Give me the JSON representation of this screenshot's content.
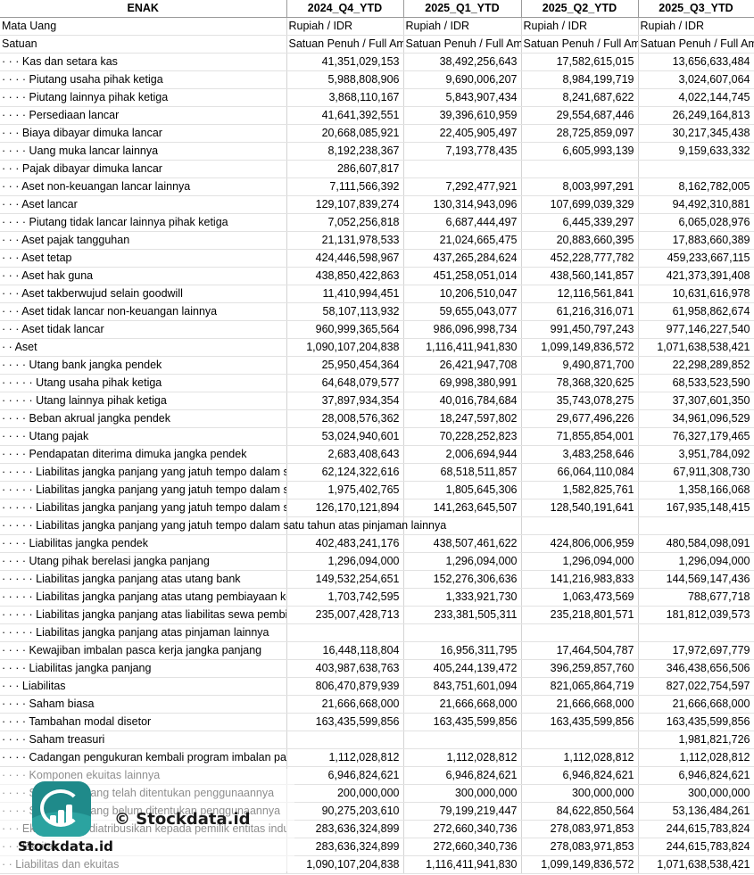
{
  "header": {
    "label": "ENAK",
    "periods": [
      "2024_Q4_YTD",
      "2025_Q1_YTD",
      "2025_Q2_YTD",
      "2025_Q3_YTD"
    ]
  },
  "meta_rows": [
    {
      "label": "Mata Uang",
      "values": [
        "Rupiah / IDR",
        "Rupiah / IDR",
        "Rupiah / IDR",
        "Rupiah / IDR"
      ]
    },
    {
      "label": "Satuan",
      "values": [
        "Satuan Penuh / Full Amount",
        "Satuan Penuh / Full Amount",
        "Satuan Penuh / Full Amount",
        "Satuan Penuh / Full Amount"
      ]
    }
  ],
  "rows": [
    {
      "label": "· · · Kas dan setara kas",
      "values": [
        "41,351,029,153",
        "38,492,256,643",
        "17,582,615,015",
        "13,656,633,484"
      ]
    },
    {
      "label": "· · · · Piutang usaha pihak ketiga",
      "values": [
        "5,988,808,906",
        "9,690,006,207",
        "8,984,199,719",
        "3,024,607,064"
      ]
    },
    {
      "label": "· · · · Piutang lainnya pihak ketiga",
      "values": [
        "3,868,110,167",
        "5,843,907,434",
        "8,241,687,622",
        "4,022,144,745"
      ]
    },
    {
      "label": "· · · · Persediaan lancar",
      "values": [
        "41,641,392,551",
        "39,396,610,959",
        "29,554,687,446",
        "26,249,164,813"
      ]
    },
    {
      "label": "· · · Biaya dibayar dimuka lancar",
      "values": [
        "20,668,085,921",
        "22,405,905,497",
        "28,725,859,097",
        "30,217,345,438"
      ]
    },
    {
      "label": "· · · · Uang muka lancar lainnya",
      "values": [
        "8,192,238,367",
        "7,193,778,435",
        "6,605,993,139",
        "9,159,633,332"
      ]
    },
    {
      "label": "· · · Pajak dibayar dimuka lancar",
      "values": [
        "286,607,817",
        "",
        "",
        ""
      ]
    },
    {
      "label": "· · · Aset non-keuangan lancar lainnya",
      "values": [
        "7,111,566,392",
        "7,292,477,921",
        "8,003,997,291",
        "8,162,782,005"
      ]
    },
    {
      "label": "· · · Aset lancar",
      "values": [
        "129,107,839,274",
        "130,314,943,096",
        "107,699,039,329",
        "94,492,310,881"
      ]
    },
    {
      "label": "· · · · Piutang tidak lancar lainnya pihak ketiga",
      "values": [
        "7,052,256,818",
        "6,687,444,497",
        "6,445,339,297",
        "6,065,028,976"
      ]
    },
    {
      "label": "· · · Aset pajak tangguhan",
      "values": [
        "21,131,978,533",
        "21,024,665,475",
        "20,883,660,395",
        "17,883,660,389"
      ]
    },
    {
      "label": "· · · Aset tetap",
      "values": [
        "424,446,598,967",
        "437,265,284,624",
        "452,228,777,782",
        "459,233,667,115"
      ]
    },
    {
      "label": "· · · Aset hak guna",
      "values": [
        "438,850,422,863",
        "451,258,051,014",
        "438,560,141,857",
        "421,373,391,408"
      ]
    },
    {
      "label": "· · · Aset takberwujud selain goodwill",
      "values": [
        "11,410,994,451",
        "10,206,510,047",
        "12,116,561,841",
        "10,631,616,978"
      ]
    },
    {
      "label": "· · · Aset tidak lancar non-keuangan lainnya",
      "values": [
        "58,107,113,932",
        "59,655,043,077",
        "61,216,316,071",
        "61,958,862,674"
      ]
    },
    {
      "label": "· · · Aset tidak lancar",
      "values": [
        "960,999,365,564",
        "986,096,998,734",
        "991,450,797,243",
        "977,146,227,540"
      ]
    },
    {
      "label": "· · Aset",
      "values": [
        "1,090,107,204,838",
        "1,116,411,941,830",
        "1,099,149,836,572",
        "1,071,638,538,421"
      ]
    },
    {
      "label": "· · · · Utang bank jangka pendek",
      "values": [
        "25,950,454,364",
        "26,421,947,708",
        "9,490,871,700",
        "22,298,289,852"
      ]
    },
    {
      "label": "· · · · · Utang usaha pihak ketiga",
      "values": [
        "64,648,079,577",
        "69,998,380,991",
        "78,368,320,625",
        "68,533,523,590"
      ]
    },
    {
      "label": "· · · · · Utang lainnya pihak ketiga",
      "values": [
        "37,897,934,354",
        "40,016,784,684",
        "35,743,078,275",
        "37,307,601,350"
      ]
    },
    {
      "label": "· · · · Beban akrual jangka pendek",
      "values": [
        "28,008,576,362",
        "18,247,597,802",
        "29,677,496,226",
        "34,961,096,529"
      ]
    },
    {
      "label": "· · · · Utang pajak",
      "values": [
        "53,024,940,601",
        "70,228,252,823",
        "71,855,854,001",
        "76,327,179,465"
      ]
    },
    {
      "label": "· · · · Pendapatan diterima dimuka jangka pendek",
      "values": [
        "2,683,408,643",
        "2,006,694,944",
        "3,483,258,646",
        "3,951,784,092"
      ]
    },
    {
      "label": "· · · · · Liabilitas jangka panjang yang jatuh tempo dalam satu tahun atas utang bank",
      "values": [
        "62,124,322,616",
        "68,518,511,857",
        "66,064,110,084",
        "67,911,308,730"
      ]
    },
    {
      "label": "· · · · · Liabilitas jangka panjang yang jatuh tempo dalam satu tahun atas utang pembiayaan konsumen",
      "values": [
        "1,975,402,765",
        "1,805,645,306",
        "1,582,825,761",
        "1,358,166,068"
      ]
    },
    {
      "label": "· · · · · Liabilitas jangka panjang yang jatuh tempo dalam satu tahun atas liabilitas sewa pembiayaan",
      "values": [
        "126,170,121,894",
        "141,263,645,507",
        "128,540,191,641",
        "167,935,148,415"
      ]
    },
    {
      "label": "· · · · · Liabilitas jangka panjang yang jatuh tempo dalam satu tahun atas pinjaman lainnya",
      "values": [
        "",
        "",
        "",
        ""
      ],
      "overflow": true
    },
    {
      "label": "· · · · Liabilitas jangka pendek",
      "values": [
        "402,483,241,176",
        "438,507,461,622",
        "424,806,006,959",
        "480,584,098,091"
      ]
    },
    {
      "label": "· · · · Utang pihak berelasi jangka panjang",
      "values": [
        "1,296,094,000",
        "1,296,094,000",
        "1,296,094,000",
        "1,296,094,000"
      ]
    },
    {
      "label": "· · · · · Liabilitas jangka panjang atas utang bank",
      "values": [
        "149,532,254,651",
        "152,276,306,636",
        "141,216,983,833",
        "144,569,147,436"
      ]
    },
    {
      "label": "· · · · · Liabilitas jangka panjang atas utang pembiayaan konsumen",
      "values": [
        "1,703,742,595",
        "1,333,921,730",
        "1,063,473,569",
        "788,677,718"
      ]
    },
    {
      "label": "· · · · · Liabilitas jangka panjang atas liabilitas sewa pembiayaan",
      "values": [
        "235,007,428,713",
        "233,381,505,311",
        "235,218,801,571",
        "181,812,039,573"
      ]
    },
    {
      "label": "· · · · · Liabilitas jangka panjang atas pinjaman lainnya",
      "values": [
        "",
        "",
        "",
        ""
      ]
    },
    {
      "label": "· · · · Kewajiban imbalan pasca kerja jangka panjang",
      "values": [
        "16,448,118,804",
        "16,956,311,795",
        "17,464,504,787",
        "17,972,697,779"
      ]
    },
    {
      "label": "· · · · Liabilitas jangka panjang",
      "values": [
        "403,987,638,763",
        "405,244,139,472",
        "396,259,857,760",
        "346,438,656,506"
      ]
    },
    {
      "label": "· · · Liabilitas",
      "values": [
        "806,470,879,939",
        "843,751,601,094",
        "821,065,864,719",
        "827,022,754,597"
      ]
    },
    {
      "label": "· · · · Saham biasa",
      "values": [
        "21,666,668,000",
        "21,666,668,000",
        "21,666,668,000",
        "21,666,668,000"
      ]
    },
    {
      "label": "· · · · Tambahan modal disetor",
      "values": [
        "163,435,599,856",
        "163,435,599,856",
        "163,435,599,856",
        "163,435,599,856"
      ]
    },
    {
      "label": "· · · · Saham treasuri",
      "values": [
        "",
        "",
        "",
        "1,981,821,726"
      ]
    },
    {
      "label": "· · · · Cadangan pengukuran kembali program imbalan pasti",
      "values": [
        "1,112,028,812",
        "1,112,028,812",
        "1,112,028,812",
        "1,112,028,812"
      ]
    },
    {
      "label": "· · · · Komponen ekuitas lainnya",
      "values": [
        "6,946,824,621",
        "6,946,824,621",
        "6,946,824,621",
        "6,946,824,621"
      ]
    },
    {
      "label": "· · · · Saldo laba yang telah ditentukan penggunaannya",
      "values": [
        "200,000,000",
        "300,000,000",
        "300,000,000",
        "300,000,000"
      ]
    },
    {
      "label": "· · · · Saldo laba yang belum ditentukan penggunaannya",
      "values": [
        "90,275,203,610",
        "79,199,219,447",
        "84,622,850,564",
        "53,136,484,261"
      ]
    },
    {
      "label": "· · · Ekuitas yang diatribusikan kepada pemilik entitas induk",
      "values": [
        "283,636,324,899",
        "272,660,340,736",
        "278,083,971,853",
        "244,615,783,824"
      ]
    },
    {
      "label": "· · · Ekuitas",
      "values": [
        "283,636,324,899",
        "272,660,340,736",
        "278,083,971,853",
        "244,615,783,824"
      ]
    },
    {
      "label": "· · Liabilitas dan ekuitas",
      "values": [
        "1,090,107,204,838",
        "1,116,411,941,830",
        "1,099,149,836,572",
        "1,071,638,538,421"
      ]
    }
  ],
  "watermark": {
    "text": "© Stockdata.id",
    "brand": "Stockdata.id",
    "logo_icon": "stockdata-chart-logo-icon",
    "logo_color": "#1f8a8a"
  }
}
